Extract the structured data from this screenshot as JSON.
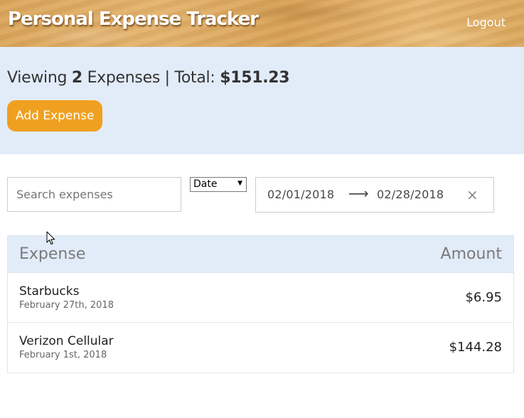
{
  "header": {
    "title": "Personal Expense Tracker",
    "logout_label": "Logout"
  },
  "summary": {
    "prefix": "Viewing",
    "count": "2",
    "middle": "Expenses | Total:",
    "total": "$151.23",
    "add_button_label": "Add Expense"
  },
  "filters": {
    "search_placeholder": "Search expenses",
    "sort_by": "Date",
    "start_date": "02/01/2018",
    "end_date": "02/28/2018",
    "range_arrow": "⟶",
    "clear_icon": "×"
  },
  "table": {
    "columns": [
      "Expense",
      "Amount"
    ],
    "rows": [
      {
        "description": "Starbucks",
        "date": "February 27th, 2018",
        "amount": "$6.95"
      },
      {
        "description": "Verizon Cellular",
        "date": "February 1st, 2018",
        "amount": "$144.28"
      }
    ]
  },
  "colors": {
    "accent": "#f0a020",
    "band": "#e2ecf9"
  }
}
